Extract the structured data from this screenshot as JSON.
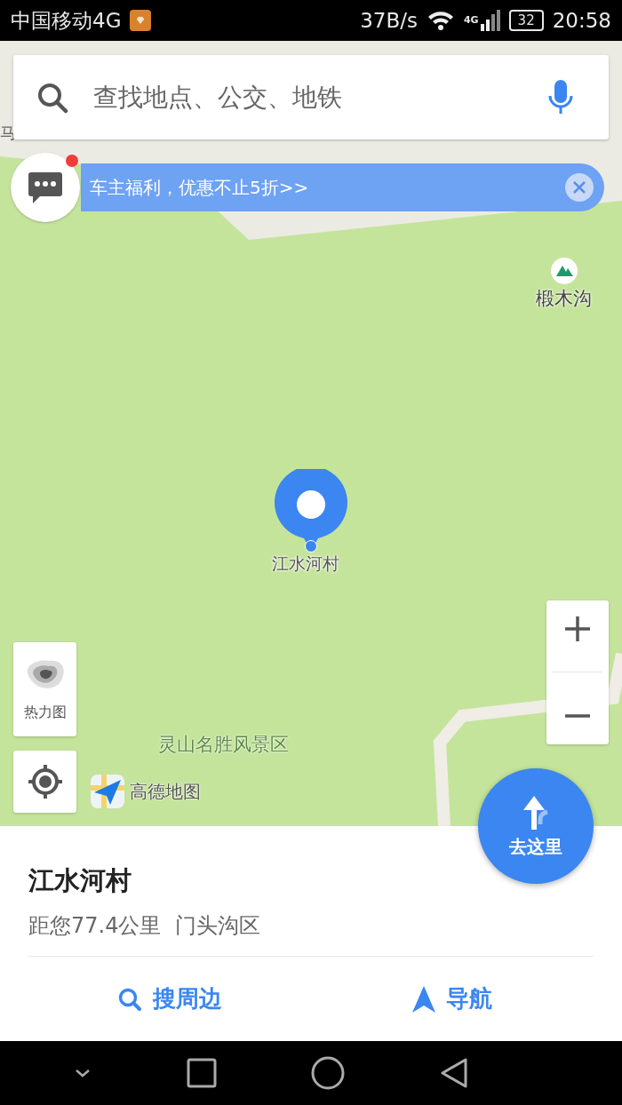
{
  "status_bar": {
    "carrier": "中国移动4G",
    "speed": "37B/s",
    "network": "4G",
    "battery": "32",
    "time": "20:58"
  },
  "search": {
    "placeholder": "查找地点、公交、地铁"
  },
  "promo": {
    "text": "车主福利，优惠不止5折>>",
    "unread": true
  },
  "map": {
    "edge_label": "马",
    "poi": "椴木沟",
    "area_label": "灵山名胜风景区",
    "pin_label": "江水河村",
    "heatmap_label": "热力图",
    "logo": "高德地图",
    "go_button": "去这里"
  },
  "place": {
    "name": "江水河村",
    "detail": "距您77.4公里  门头沟区"
  },
  "actions": [
    {
      "label": "搜周边",
      "kind": "search"
    },
    {
      "label": "导航",
      "kind": "navigate"
    }
  ]
}
